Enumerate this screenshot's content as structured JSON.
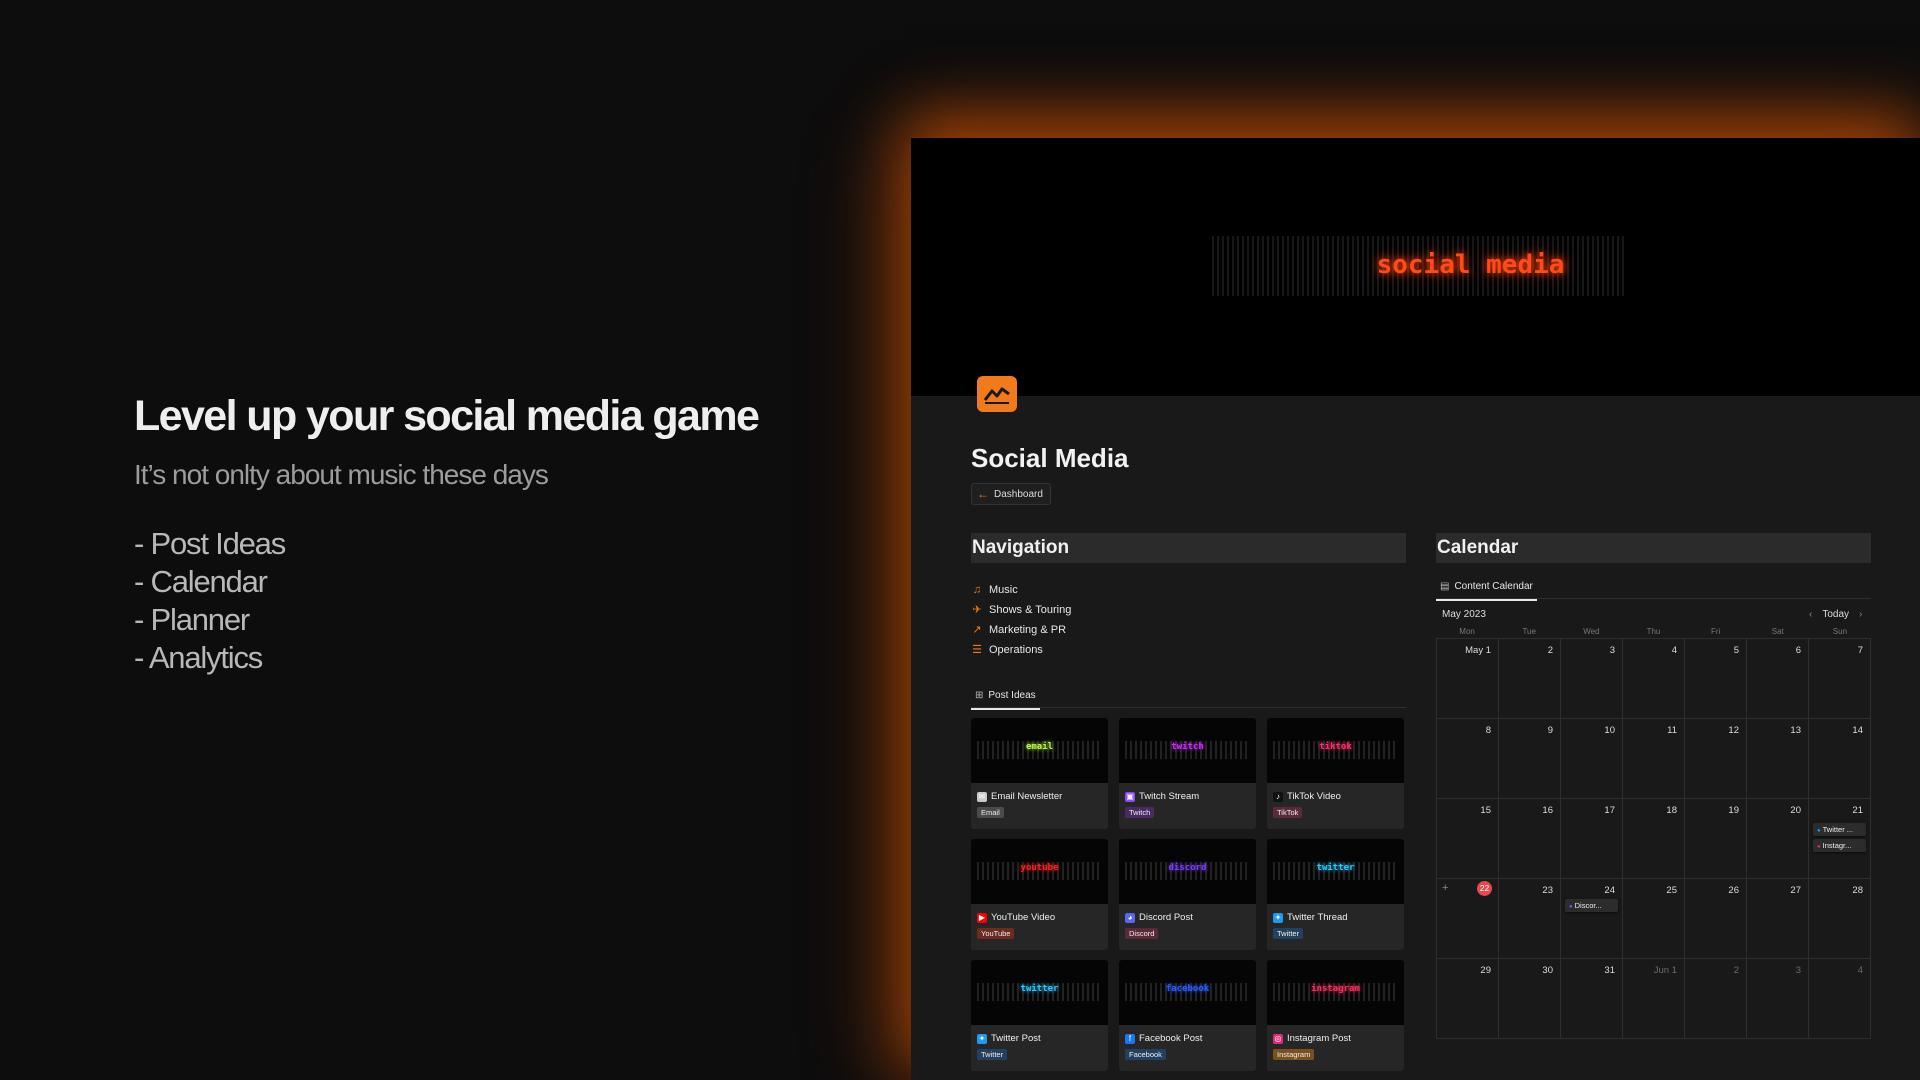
{
  "promo": {
    "headline": "Level up your social media game",
    "subheadline": "It’s not onlty about music these days",
    "items": [
      "- Post Ideas",
      "- Calendar",
      "- Planner",
      "- Analytics"
    ]
  },
  "app": {
    "cover_text": "social media",
    "page_title": "Social Media",
    "breadcrumb": "Dashboard",
    "accent": "#f07a1c",
    "navigation": {
      "heading": "Navigation",
      "items": [
        {
          "label": "Music",
          "icon": "music-icon"
        },
        {
          "label": "Shows & Touring",
          "icon": "touring-icon"
        },
        {
          "label": "Marketing & PR",
          "icon": "chart-icon"
        },
        {
          "label": "Operations",
          "icon": "checklist-icon"
        }
      ]
    },
    "post_ideas": {
      "tab": "Post Ideas",
      "cards": [
        {
          "thumb": "email",
          "thumb_color": "#b6ff3a",
          "title": "Email Newsletter",
          "tag": "Email",
          "tag_color": "#4a4a4a",
          "icon_color": "#c9c9c9",
          "icon_glyph": "✉"
        },
        {
          "thumb": "twitch",
          "thumb_color": "#c72bff",
          "title": "Twitch Stream",
          "tag": "Twitch",
          "tag_color": "#4a2a63",
          "icon_color": "#9146ff",
          "icon_glyph": "▣"
        },
        {
          "thumb": "tiktok",
          "thumb_color": "#ff2d6b",
          "title": "TikTok Video",
          "tag": "TikTok",
          "tag_color": "#5a2a3a",
          "icon_color": "#111111",
          "icon_glyph": "♪"
        },
        {
          "thumb": "youtube",
          "thumb_color": "#ff1e1e",
          "title": "YouTube Video",
          "tag": "YouTube",
          "tag_color": "#6b2a22",
          "icon_color": "#ff0000",
          "icon_glyph": "▶"
        },
        {
          "thumb": "discord",
          "thumb_color": "#7a3bff",
          "title": "Discord Post",
          "tag": "Discord",
          "tag_color": "#5a2a38",
          "icon_color": "#5865f2",
          "icon_glyph": "◕"
        },
        {
          "thumb": "twitter",
          "thumb_color": "#27c8ff",
          "title": "Twitter Thread",
          "tag": "Twitter",
          "tag_color": "#23415e",
          "icon_color": "#1d9bf0",
          "icon_glyph": "✦"
        },
        {
          "thumb": "twitter",
          "thumb_color": "#27c8ff",
          "title": "Twitter Post",
          "tag": "Twitter",
          "tag_color": "#23415e",
          "icon_color": "#1d9bf0",
          "icon_glyph": "✦"
        },
        {
          "thumb": "facebook",
          "thumb_color": "#2a5cff",
          "title": "Facebook Post",
          "tag": "Facebook",
          "tag_color": "#23415e",
          "icon_color": "#1877f2",
          "icon_glyph": "f"
        },
        {
          "thumb": "instagram",
          "thumb_color": "#ff2a5a",
          "title": "Instagram Post",
          "tag": "Instagram",
          "tag_color": "#7a5020",
          "icon_color": "#dd2a7b",
          "icon_glyph": "◎"
        }
      ]
    },
    "calendar": {
      "heading": "Calendar",
      "tab": "Content Calendar",
      "month": "May 2023",
      "today_label": "Today",
      "days_of_week": [
        "Mon",
        "Tue",
        "Wed",
        "Thu",
        "Fri",
        "Sat",
        "Sun"
      ],
      "weeks": [
        [
          "May 1",
          "2",
          "3",
          "4",
          "5",
          "6",
          "7"
        ],
        [
          "8",
          "9",
          "10",
          "11",
          "12",
          "13",
          "14"
        ],
        [
          "15",
          "16",
          "17",
          "18",
          "19",
          "20",
          "21"
        ],
        [
          "22",
          "23",
          "24",
          "25",
          "26",
          "27",
          "28"
        ],
        [
          "29",
          "30",
          "31",
          "Jun 1",
          "2",
          "3",
          "4"
        ]
      ],
      "today_date": "22",
      "events": [
        {
          "week": 2,
          "day": 6,
          "slot": 0,
          "label": "Twitter ...",
          "icon": "twitter-icon",
          "color": "#1d9bf0"
        },
        {
          "week": 2,
          "day": 6,
          "slot": 1,
          "label": "Instagr...",
          "icon": "instagram-icon",
          "color": "#dd2a7b"
        },
        {
          "week": 3,
          "day": 2,
          "slot": 0,
          "label": "Discor...",
          "icon": "discord-icon",
          "color": "#5865f2"
        }
      ]
    }
  }
}
